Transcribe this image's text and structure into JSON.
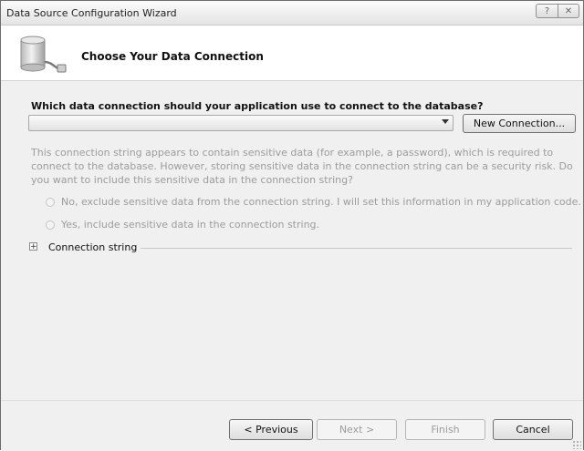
{
  "window": {
    "title": "Data Source Configuration Wizard"
  },
  "titlebar": {
    "help_label": "?",
    "close_label": "✕"
  },
  "header": {
    "heading": "Choose Your Data Connection",
    "icon": "database-plug-icon"
  },
  "connection": {
    "question": "Which data connection should your application use to connect to the database?",
    "selected_value": "",
    "new_connection_label": "New Connection..."
  },
  "sensitive": {
    "description": "This connection string appears to contain sensitive data (for example, a password), which is required to connect to the database. However, storing sensitive data in the connection string can be a security risk. Do you want to include this sensitive data in the connection string?",
    "option_no": "No, exclude sensitive data from the connection string. I will set this information in my application code.",
    "option_yes": "Yes, include sensitive data in the connection string."
  },
  "expander": {
    "label": "Connection string",
    "toggle": "+"
  },
  "footer": {
    "previous_label": "< Previous",
    "next_label": "Next >",
    "finish_label": "Finish",
    "cancel_label": "Cancel"
  }
}
